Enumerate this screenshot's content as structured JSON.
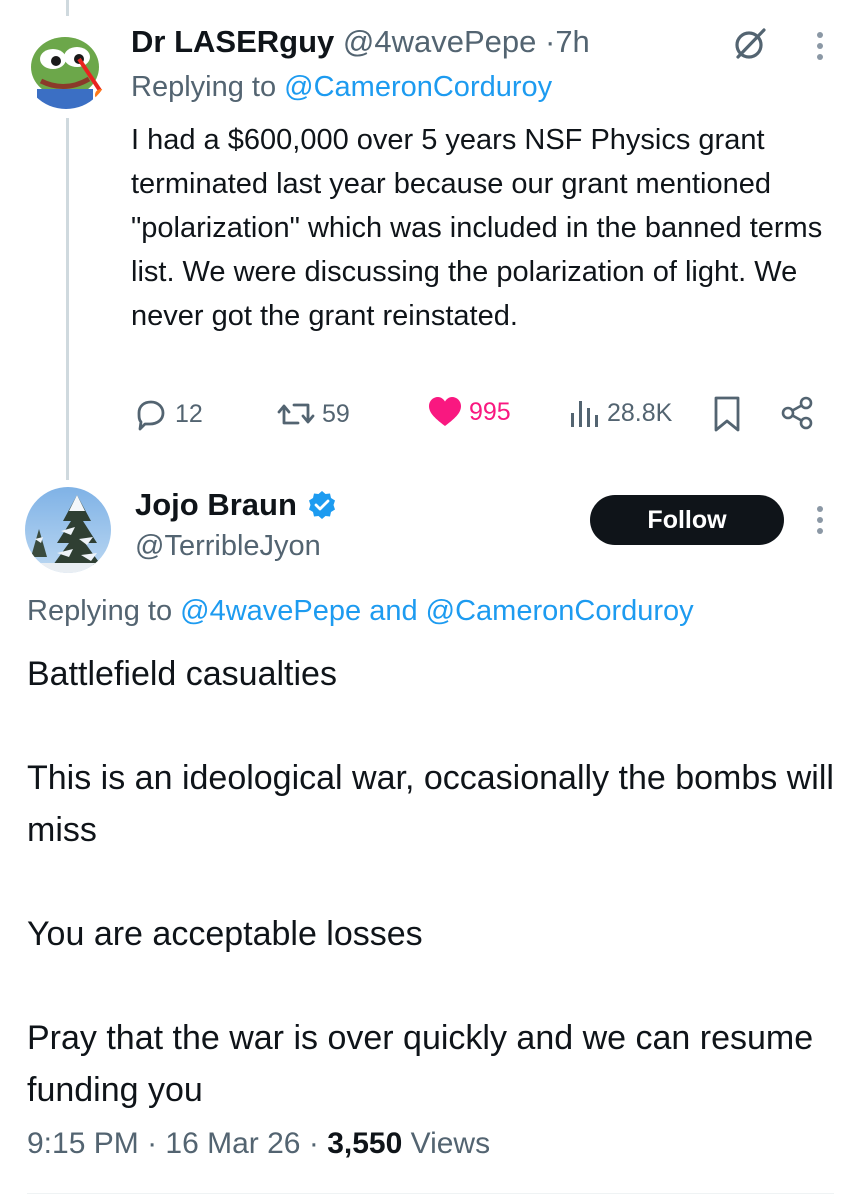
{
  "reply1": {
    "display_name": "Dr LASERguy",
    "handle": "@4wavePepe",
    "separator": "·",
    "time": "7h",
    "replying_prefix": "Replying to",
    "replying_to": "@CameronCorduroy",
    "text": "I had a $600,000 over 5 years NSF Physics grant terminated last year because our grant mentioned \"polarization\" which was included in the banned terms list. We were discussing the polarization of light. We never got the grant reinstated.",
    "stats": {
      "replies": "12",
      "reposts": "59",
      "likes": "995",
      "views": "28.8K"
    }
  },
  "main_tweet": {
    "display_name": "Jojo Braun",
    "handle": "@TerribleJyon",
    "follow_label": "Follow",
    "replying_prefix": "Replying to",
    "replying_to_1": "@4wavePepe",
    "replying_joiner": "and",
    "replying_to_2": "@CameronCorduroy",
    "paragraphs": [
      "Battlefield casualties",
      "This is an ideological war, occasionally the bombs will miss",
      "You are acceptable losses",
      "Pray that the war is over quickly and we can resume funding you"
    ],
    "time": "9:15 PM",
    "separator": "·",
    "date": "16 Mar 26",
    "views_count": "3,550",
    "views_label": "Views"
  },
  "icons": {
    "verified": "verified-badge-icon",
    "grok": "grok-icon",
    "more": "more-vertical-icon",
    "reply": "reply-icon",
    "repost": "repost-icon",
    "like": "heart-icon",
    "views": "analytics-icon",
    "bookmark": "bookmark-icon",
    "share": "share-icon"
  },
  "colors": {
    "accent": "#1d9bf0",
    "like": "#f91880",
    "muted": "#536471",
    "text": "#0f1419"
  }
}
